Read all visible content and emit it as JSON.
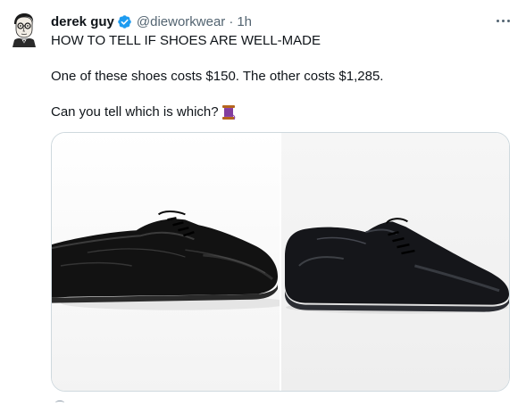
{
  "tweet": {
    "author_name": "derek guy",
    "handle": "@dieworkwear",
    "separator": "·",
    "time": "1h",
    "text_line1": "HOW TO TELL IF SHOES ARE WELL-MADE",
    "text_line2": "One of these shoes costs $150. The other costs $1,285.",
    "text_line3": "Can you tell which is which?",
    "emoji": "spool-of-thread-icon"
  },
  "icons": {
    "verified": "verified-badge-icon",
    "more": "more-options-icon"
  },
  "colors": {
    "verified_blue": "#1d9bf0",
    "text_primary": "#0f1419",
    "text_secondary": "#536471",
    "border": "#cfd9de"
  }
}
